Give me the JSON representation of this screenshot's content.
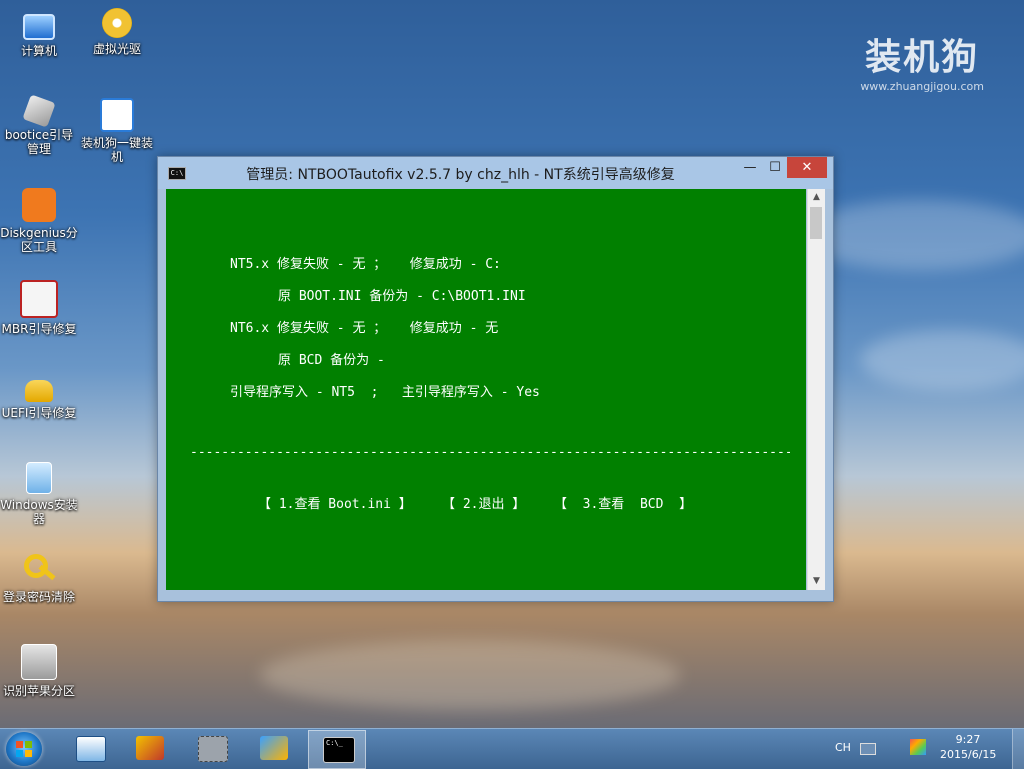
{
  "watermark": {
    "brand": "装机狗",
    "url": "www.zhuangjigou.com"
  },
  "desktop_icons": [
    {
      "label": "计算机"
    },
    {
      "label": "虚拟光驱"
    },
    {
      "label": "bootice引导管理"
    },
    {
      "label": "装机狗一键装机"
    },
    {
      "label": "Diskgenius分区工具"
    },
    {
      "label": "MBR引导修复"
    },
    {
      "label": "UEFI引导修复"
    },
    {
      "label": "Windows安装器"
    },
    {
      "label": "登录密码清除"
    },
    {
      "label": "识别苹果分区"
    }
  ],
  "window": {
    "icon_text": "C:\\",
    "title": "管理员: NTBOOTautofix v2.5.7 by chz_hlh - NT系统引导高级修复",
    "min": "—",
    "max": "☐",
    "close": "✕"
  },
  "console": {
    "line1": "NT5.x 修复失败 - 无 ；   修复成功 - C:",
    "line2": "原 BOOT.INI 备份为 - C:\\BOOT1.INI",
    "line3": "NT6.x 修复失败 - 无 ；   修复成功 - 无",
    "line4": "原 BCD 备份为 -",
    "line5": "引导程序写入 - NT5  ;   主引导程序写入 - Yes",
    "divider": "-----------------------------------------------------------------------------------------",
    "menu": [
      {
        "label": "【 1.查看 Boot.ini 】"
      },
      {
        "label": "【 2.退出 】"
      },
      {
        "label": "【  3.查看  BCD  】"
      }
    ]
  },
  "taskbar": {
    "lang": "CH",
    "time": "9:27",
    "date": "2015/6/15",
    "cmd_icon_text": "C:\\_"
  }
}
